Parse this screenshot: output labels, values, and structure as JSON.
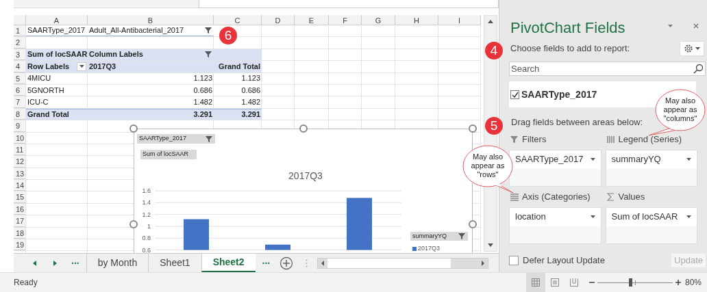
{
  "sheet": {
    "columns": [
      "A",
      "B",
      "C",
      "D",
      "E",
      "F",
      "G",
      "H",
      "I"
    ],
    "rows": [
      {
        "number": "1",
        "kind": "filter",
        "cells": [
          {
            "kind": "plain",
            "text": "SAARType_2017"
          },
          {
            "kind": "filter",
            "text": "Adult_All-Antibacterial_2017"
          }
        ]
      },
      {
        "number": "2",
        "kind": "blank",
        "cells": []
      },
      {
        "number": "3",
        "kind": "header",
        "cells": [
          {
            "kind": "plain",
            "text": "Sum of locSAAR"
          },
          {
            "kind": "filter",
            "text": "Column Labels"
          }
        ]
      },
      {
        "number": "4",
        "kind": "header",
        "cells": [
          {
            "kind": "dropdown",
            "text": "Row Labels"
          },
          {
            "kind": "plain",
            "text": "2017Q3"
          },
          {
            "kind": "plain",
            "text": "Grand Total"
          }
        ]
      },
      {
        "number": "5",
        "kind": "data",
        "cells": [
          {
            "kind": "plain",
            "text": "4MICU"
          },
          {
            "kind": "plain",
            "text": "1.123"
          },
          {
            "kind": "plain",
            "text": "1.123"
          }
        ]
      },
      {
        "number": "6",
        "kind": "data",
        "cells": [
          {
            "kind": "plain",
            "text": "5GNORTH"
          },
          {
            "kind": "plain",
            "text": "0.686"
          },
          {
            "kind": "plain",
            "text": "0.686"
          }
        ]
      },
      {
        "number": "7",
        "kind": "data",
        "cells": [
          {
            "kind": "plain",
            "text": "ICU-C"
          },
          {
            "kind": "plain",
            "text": "1.482"
          },
          {
            "kind": "plain",
            "text": "1.482"
          }
        ]
      },
      {
        "number": "8",
        "kind": "total",
        "cells": [
          {
            "kind": "plain",
            "text": "Grand Total"
          },
          {
            "kind": "plain",
            "text": "3.291"
          },
          {
            "kind": "plain",
            "text": "3.291"
          }
        ]
      },
      {
        "number": "9",
        "kind": "blank",
        "cells": []
      },
      {
        "number": "10",
        "kind": "blank",
        "cells": []
      },
      {
        "number": "11",
        "kind": "blank",
        "cells": []
      },
      {
        "number": "12",
        "kind": "blank",
        "cells": []
      },
      {
        "number": "13",
        "kind": "blank",
        "cells": []
      },
      {
        "number": "14",
        "kind": "blank",
        "cells": []
      },
      {
        "number": "15",
        "kind": "blank",
        "cells": []
      },
      {
        "number": "16",
        "kind": "blank",
        "cells": []
      },
      {
        "number": "17",
        "kind": "blank",
        "cells": []
      },
      {
        "number": "18",
        "kind": "blank",
        "cells": []
      },
      {
        "number": "19",
        "kind": "blank",
        "cells": []
      }
    ]
  },
  "chart": {
    "filter_buttons": [
      {
        "label": "SAARType_2017",
        "filter": true
      },
      {
        "label": "Sum of locSAAR",
        "filter": false
      }
    ],
    "legend_button": {
      "label": "summaryYQ"
    },
    "chart_data": {
      "type": "bar",
      "title": "2017Q3",
      "grid": true,
      "series": [
        {
          "name": "2017Q3",
          "color": "#4472c4",
          "values": [
            1.12,
            0.69,
            1.48
          ]
        }
      ],
      "yticks": [
        0.6,
        0.8,
        1,
        1.2,
        1.4,
        1.6
      ],
      "ylim": [
        0.6,
        1.6
      ]
    }
  },
  "callouts": [
    {
      "kind": "number",
      "text": "6"
    },
    {
      "kind": "number",
      "text": "4"
    },
    {
      "kind": "number",
      "text": "5"
    },
    {
      "kind": "bubble",
      "text": "May also appear as \"columns\""
    },
    {
      "kind": "bubble",
      "text": "May also appear as \"rows\""
    }
  ],
  "sheet_tabs": {
    "overflow": [
      "...",
      "..."
    ],
    "tabs": [
      {
        "label": "by Month",
        "selected": false
      },
      {
        "label": "Sheet1",
        "selected": false
      },
      {
        "label": "Sheet2",
        "selected": true
      }
    ]
  },
  "panel": {
    "title": "PivotChart Fields",
    "prompt": "Choose fields to add to report:",
    "search": {
      "placeholder": "Search"
    },
    "fields": [
      {
        "label": "SAARType_2017",
        "checked": true
      }
    ],
    "areas_prompt": "Drag fields between areas below:",
    "areas": [
      {
        "kind": "filters",
        "title": "Filters",
        "items": [
          "SAARType_2017"
        ]
      },
      {
        "kind": "legend",
        "title": "Legend (Series)",
        "items": [
          "summaryYQ"
        ]
      },
      {
        "kind": "axis",
        "title": "Axis (Categories)",
        "items": [
          "location"
        ]
      },
      {
        "kind": "values",
        "title": "Values",
        "items": [
          "Sum of locSAAR"
        ]
      }
    ],
    "defer": {
      "label": "Defer Layout Update",
      "checked": false
    },
    "update_button": {
      "label": "Update",
      "disabled": true
    }
  },
  "status_bar": {
    "text": "Ready",
    "zoom": "80%",
    "zoom_slider": {
      "level": 0.44
    }
  }
}
